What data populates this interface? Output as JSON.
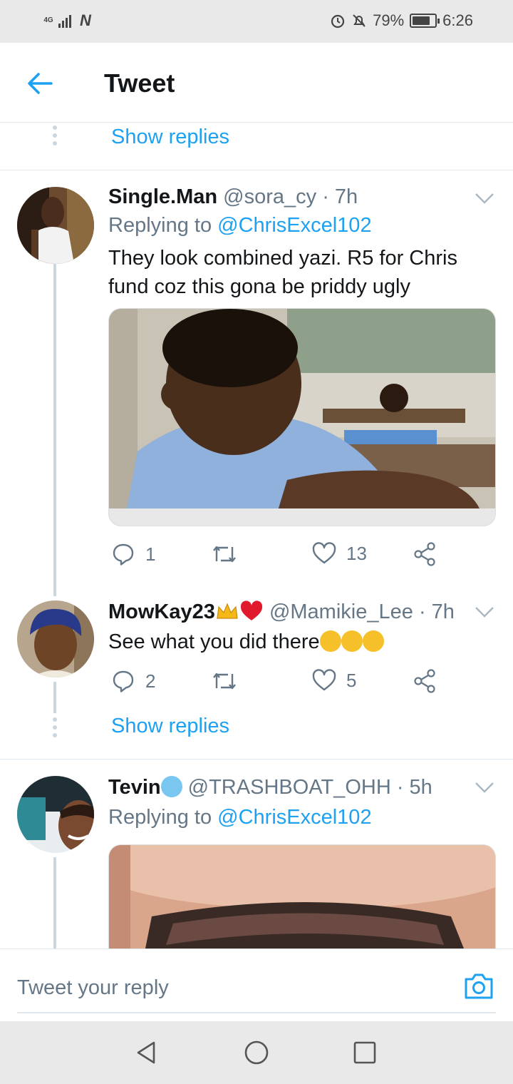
{
  "status_bar": {
    "network": "4G",
    "battery": "79%",
    "time": "6:26"
  },
  "header": {
    "title": "Tweet"
  },
  "show_replies_label": "Show replies",
  "tweets": [
    {
      "name": "Single.Man",
      "handle": "@sora_cy",
      "time": "· 7h",
      "replying_prefix": "Replying to",
      "replying_to": "@ChrisExcel102",
      "text": "They look combined yazi. R5 for Chris fund coz this gona be priddy ugly",
      "replies": "1",
      "likes": "13"
    },
    {
      "name": "MowKay23",
      "handle": "@Mamikie_Lee",
      "time": "· 7h",
      "text": "See what you did there",
      "replies": "2",
      "likes": "5"
    },
    {
      "name": "Tevin",
      "handle": "@TRASHBOAT_OHH",
      "time": "· 5h",
      "replying_prefix": "Replying to",
      "replying_to": "@ChrisExcel102"
    }
  ],
  "reply_bar": {
    "placeholder": "Tweet your reply"
  },
  "icons": {
    "back": "arrow-left-icon",
    "reply": "speech-bubble-icon",
    "retweet": "retweet-icon",
    "like": "heart-icon",
    "share": "share-icon",
    "camera": "camera-icon"
  },
  "colors": {
    "accent": "#1da1f2",
    "muted": "#657786"
  }
}
